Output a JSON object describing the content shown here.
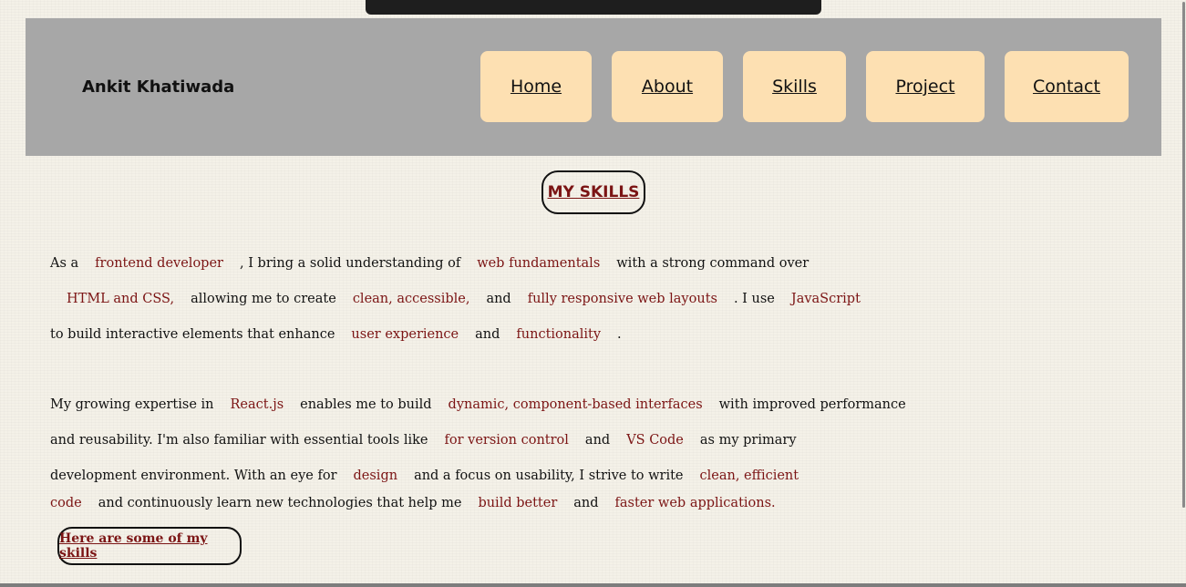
{
  "header": {
    "brand": "Ankit Khatiwada",
    "nav": [
      "Home",
      "About",
      "Skills",
      "Project",
      "Contact"
    ]
  },
  "section": {
    "title": "MY SKILLS",
    "paragraph1": {
      "line1": [
        "As a",
        "frontend developer",
        ", I bring a solid understanding of",
        "web fundamentals",
        "with a strong command over"
      ],
      "line2": [
        "HTML and CSS,",
        "allowing me to create",
        "clean, accessible,",
        "and",
        "fully responsive web layouts",
        ". I use",
        "JavaScript"
      ],
      "line3": [
        "to build interactive elements that enhance",
        "user experience",
        "and",
        "functionality",
        "."
      ]
    },
    "paragraph2": {
      "line1": [
        "My growing expertise in",
        "React.js",
        "enables me to build",
        "dynamic, component-based interfaces",
        "with improved performance"
      ],
      "line2": [
        "and reusability. I'm also familiar with essential tools like",
        "for version control",
        "and",
        "VS Code",
        "as my primary"
      ],
      "line3": [
        "development environment. With an eye for",
        "design",
        "and a focus on usability, I strive to write",
        "clean, efficient"
      ],
      "line4": [
        "code",
        "and continuously learn new technologies that help me",
        "build better",
        "and",
        "faster web applications."
      ]
    },
    "skills_button": "Here are some of my skills"
  },
  "colors": {
    "accent": "#7b1414",
    "header_bg": "#a7a7a7",
    "nav_bg": "#fde0b2",
    "page_bg": "#f4f1e8"
  }
}
